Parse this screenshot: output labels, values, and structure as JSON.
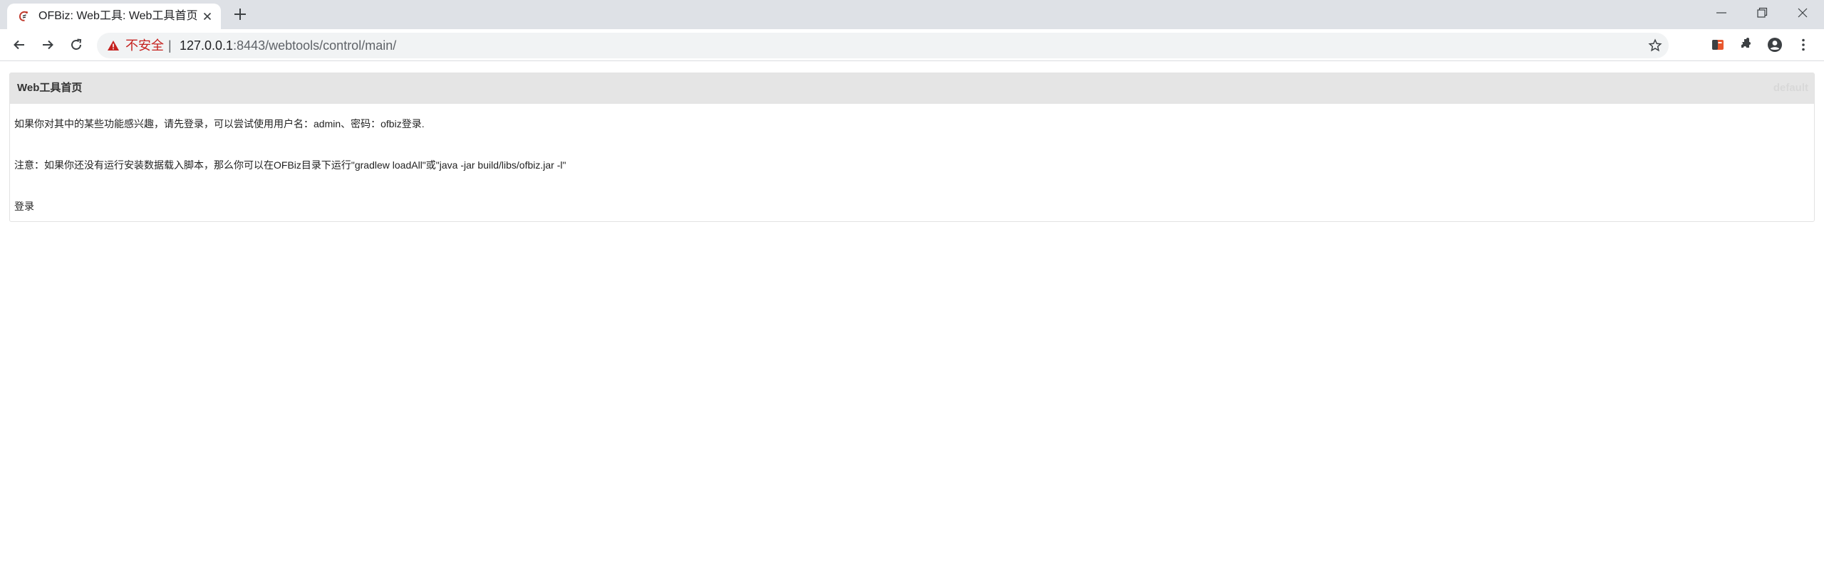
{
  "browser": {
    "tab": {
      "title": "OFBiz: Web工具: Web工具首页"
    },
    "address_bar": {
      "security_label": "不安全",
      "separator": "|",
      "url_host": "127.0.0.1",
      "url_rest": ":8443/webtools/control/main/"
    },
    "icons": {
      "favicon": "ofbiz-favicon-icon",
      "back": "arrow-left-icon",
      "forward": "arrow-right-icon",
      "reload": "reload-icon",
      "warning": "warning-triangle-icon",
      "bookmark": "star-icon",
      "extension": "extension-icon",
      "extensions_menu": "puzzle-icon",
      "profile": "account-circle-icon",
      "menu": "vertical-dots-icon",
      "minimize": "minimize-icon",
      "restore": "restore-icon",
      "close": "close-icon"
    },
    "colors": {
      "tabstrip": "#dee1e6",
      "omnibox": "#f1f3f4",
      "insecure": "#c5221f"
    }
  },
  "page": {
    "screenlet": {
      "title": "Web工具首页",
      "visual_theme": "default"
    },
    "intro_text": "如果你对其中的某些功能感兴趣，请先登录，可以尝试使用用户名：admin、密码：ofbiz登录.",
    "note_text": "注意：如果你还没有运行安装数据载入脚本，那么你可以在OFBiz目录下运行\"gradlew loadAll\"或\"java -jar build/libs/ofbiz.jar -l\"",
    "login_link": "登录"
  }
}
